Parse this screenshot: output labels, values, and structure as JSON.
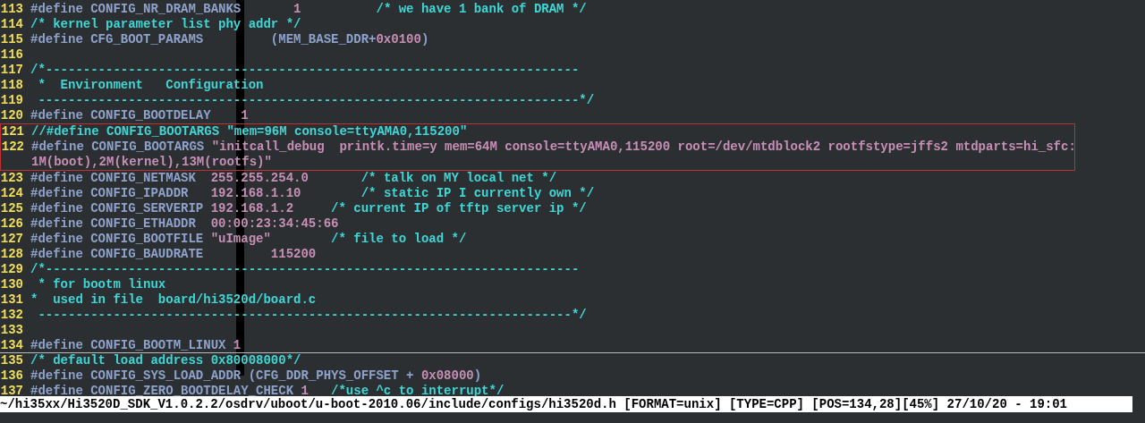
{
  "editor": {
    "cursor_column_highlight": true,
    "lines": [
      {
        "number": "113",
        "segments": [
          {
            "kind": "preproc",
            "text": "#define CONFIG_NR_DRAM_BANKS       "
          },
          {
            "kind": "number",
            "text": "1          "
          },
          {
            "kind": "comment",
            "text": "/* we have 1 bank of DRAM */"
          }
        ]
      },
      {
        "number": "114",
        "segments": [
          {
            "kind": "comment",
            "text": "/* kernel parameter list phy addr */"
          }
        ]
      },
      {
        "number": "115",
        "segments": [
          {
            "kind": "preproc",
            "text": "#define CFG_BOOT_PARAMS         (MEM_BASE_DDR+"
          },
          {
            "kind": "number",
            "text": "0x0100"
          },
          {
            "kind": "preproc",
            "text": ")"
          }
        ]
      },
      {
        "number": "116"
      },
      {
        "number": "117",
        "segments": [
          {
            "kind": "comment",
            "text": "/*-----------------------------------------------------------------------"
          }
        ]
      },
      {
        "number": "118",
        "segments": [
          {
            "kind": "comment",
            "text": " *  Environment   Configuration"
          }
        ]
      },
      {
        "number": "119",
        "segments": [
          {
            "kind": "comment",
            "text": " ------------------------------------------------------------------------*/"
          }
        ]
      },
      {
        "number": "120",
        "segments": [
          {
            "kind": "preproc",
            "text": "#define CONFIG_BOOTDELAY    "
          },
          {
            "kind": "number",
            "text": "1"
          }
        ]
      },
      {
        "number": "121",
        "boxed": true,
        "segments": [
          {
            "kind": "comment",
            "text": "//#define CONFIG_BOOTARGS \"mem=96M console=ttyAMA0,115200\""
          }
        ]
      },
      {
        "number": "122",
        "boxed": true,
        "segments": [
          {
            "kind": "preproc",
            "text": "#define CONFIG_BOOTARGS "
          },
          {
            "kind": "string",
            "text": "\"initcall_debug  printk.time=y mem=64M console=ttyAMA0,115200 root=/dev/mtdblock2 rootfstype=jffs2 mtdparts=hi_sfc:"
          }
        ],
        "continuation": [
          {
            "kind": "string",
            "text": "1M(boot),2M(kernel),13M(rootfs)\""
          }
        ]
      },
      {
        "number": "123",
        "segments": [
          {
            "kind": "preproc",
            "text": "#define CONFIG_NETMASK  "
          },
          {
            "kind": "number",
            "text": "255.255.254.0       "
          },
          {
            "kind": "comment",
            "text": "/* talk on MY local net */"
          }
        ]
      },
      {
        "number": "124",
        "segments": [
          {
            "kind": "preproc",
            "text": "#define CONFIG_IPADDR   "
          },
          {
            "kind": "number",
            "text": "192.168.1.10        "
          },
          {
            "kind": "comment",
            "text": "/* static IP I currently own */"
          }
        ]
      },
      {
        "number": "125",
        "segments": [
          {
            "kind": "preproc",
            "text": "#define CONFIG_SERVERIP "
          },
          {
            "kind": "number",
            "text": "192.168.1.2     "
          },
          {
            "kind": "comment",
            "text": "/* current IP of tftp server ip */"
          }
        ]
      },
      {
        "number": "126",
        "segments": [
          {
            "kind": "preproc",
            "text": "#define CONFIG_ETHADDR  "
          },
          {
            "kind": "number",
            "text": "00:00:23:34:45:66"
          }
        ]
      },
      {
        "number": "127",
        "segments": [
          {
            "kind": "preproc",
            "text": "#define CONFIG_BOOTFILE "
          },
          {
            "kind": "string",
            "text": "\"uImage\"        "
          },
          {
            "kind": "comment",
            "text": "/* file to load */"
          }
        ]
      },
      {
        "number": "128",
        "segments": [
          {
            "kind": "preproc",
            "text": "#define CONFIG_BAUDRATE         "
          },
          {
            "kind": "number",
            "text": "115200"
          }
        ]
      },
      {
        "number": "129",
        "segments": [
          {
            "kind": "comment",
            "text": "/*-----------------------------------------------------------------------"
          }
        ]
      },
      {
        "number": "130",
        "segments": [
          {
            "kind": "comment",
            "text": " * for bootm linux"
          }
        ]
      },
      {
        "number": "131",
        "segments": [
          {
            "kind": "comment",
            "text": "*  used in file  board/hi3520d/board.c"
          }
        ]
      },
      {
        "number": "132",
        "segments": [
          {
            "kind": "comment",
            "text": " -----------------------------------------------------------------------*/"
          }
        ]
      },
      {
        "number": "133"
      },
      {
        "number": "134",
        "cursor_line": true,
        "segments": [
          {
            "kind": "preproc",
            "text": "#define CONFIG_BOOTM_LINUX "
          },
          {
            "kind": "number",
            "text": "1"
          }
        ]
      },
      {
        "number": "135",
        "segments": [
          {
            "kind": "comment",
            "text": "/* default load address 0x80008000*/"
          }
        ]
      },
      {
        "number": "136",
        "segments": [
          {
            "kind": "preproc",
            "text": "#define CONFIG_SYS_LOAD_ADDR (CFG_DDR_PHYS_OFFSET + "
          },
          {
            "kind": "number",
            "text": "0x08000"
          },
          {
            "kind": "preproc",
            "text": ")"
          }
        ]
      },
      {
        "number": "137",
        "segments": [
          {
            "kind": "preproc",
            "text": "#define CONFIG_ZERO_BOOTDELAY_CHECK "
          },
          {
            "kind": "number",
            "text": "1   "
          },
          {
            "kind": "comment",
            "text": "/*use ^c to interrupt*/"
          }
        ]
      }
    ]
  },
  "status_bar": {
    "text": "~/hi35xx/Hi3520D_SDK_V1.0.2.2/osdrv/uboot/u-boot-2010.06/include/configs/hi3520d.h [FORMAT=unix] [TYPE=CPP] [POS=134,28][45%] 27/10/20 - 19:01"
  }
}
